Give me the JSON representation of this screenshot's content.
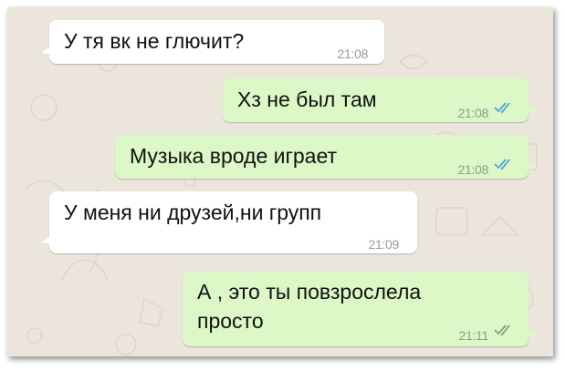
{
  "chat": {
    "background_color": "#ebe5dc",
    "incoming_color": "#ffffff",
    "outgoing_color": "#dcf8c6",
    "read_tick_color": "#4fa3e0",
    "delivered_tick_color": "#8a9a86",
    "messages": [
      {
        "direction": "incoming",
        "text": "У тя вк не глючит?",
        "time": "21:08"
      },
      {
        "direction": "outgoing",
        "text": "Хз не был там",
        "time": "21:08",
        "status": "read",
        "status_icon": "double-check-icon"
      },
      {
        "direction": "outgoing",
        "text": "Музыка вроде играет",
        "time": "21:08",
        "status": "read",
        "status_icon": "double-check-icon"
      },
      {
        "direction": "incoming",
        "text": "У меня ни друзей,ни групп",
        "time": "21:09"
      },
      {
        "direction": "outgoing",
        "text_lines": [
          "А , это ты повзрослела",
          "просто"
        ],
        "time": "21:11",
        "status": "delivered",
        "status_icon": "double-check-icon"
      }
    ]
  }
}
